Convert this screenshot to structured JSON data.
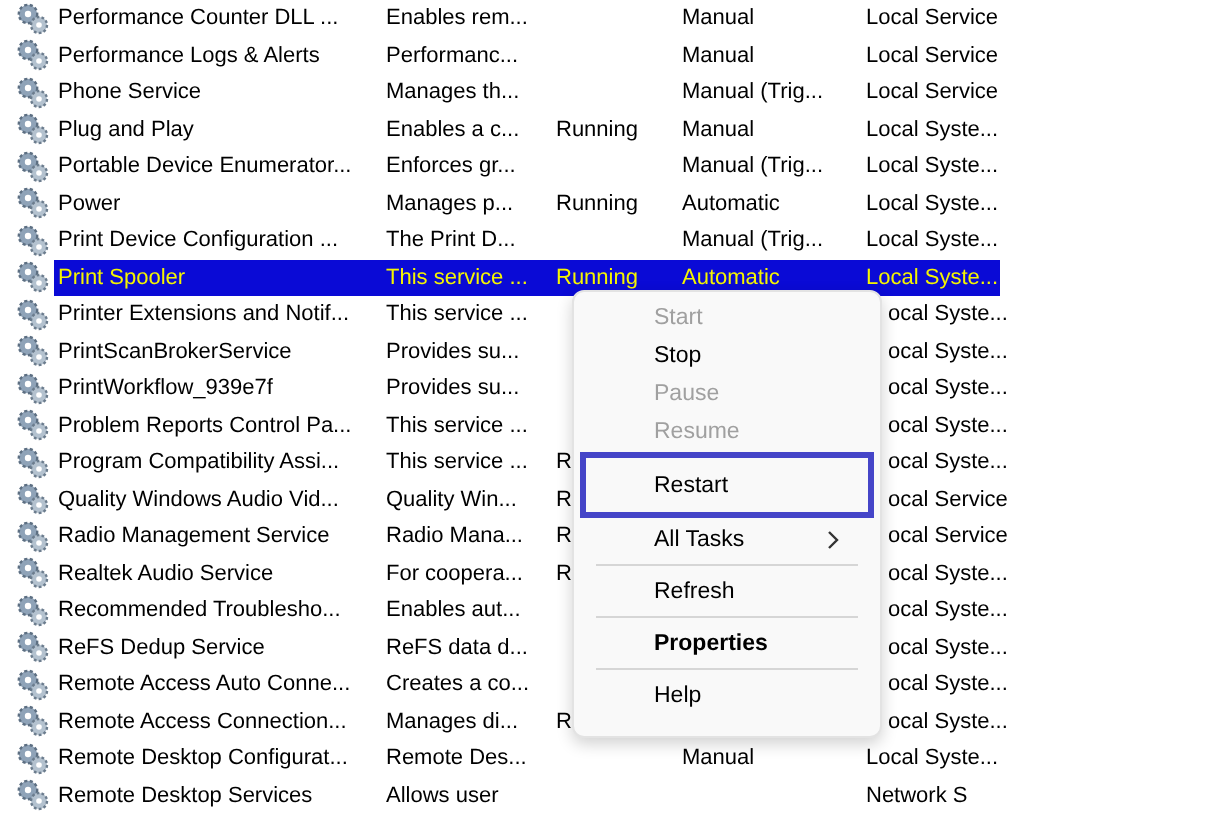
{
  "services": [
    {
      "name": "Performance Counter DLL ...",
      "description": "Enables rem...",
      "startup": "Manual",
      "logon": "Local Service",
      "selected": false
    },
    {
      "name": "Performance Logs & Alerts",
      "description": "Performanc...",
      "startup": "Manual",
      "logon": "Local Service",
      "selected": false
    },
    {
      "name": "Phone Service",
      "description": "Manages th...",
      "startup": "Manual (Trig...",
      "logon": "Local Service",
      "selected": false
    },
    {
      "name": "Plug and Play",
      "description": "Enables a c...",
      "status": "Running",
      "startup": "Manual",
      "logon": "Local Syste...",
      "selected": false
    },
    {
      "name": "Portable Device Enumerator...",
      "description": "Enforces gr...",
      "startup": "Manual (Trig...",
      "logon": "Local Syste...",
      "selected": false
    },
    {
      "name": "Power",
      "description": "Manages p...",
      "status": "Running",
      "startup": "Automatic",
      "logon": "Local Syste...",
      "selected": false
    },
    {
      "name": "Print Device Configuration ...",
      "description": "The Print D...",
      "startup": "Manual (Trig...",
      "logon": "Local Syste...",
      "selected": false
    },
    {
      "name": "Print Spooler",
      "description": "This service ...",
      "status": "Running",
      "startup": "Automatic",
      "logon": "Local Syste...",
      "selected": true
    },
    {
      "name": "Printer Extensions and Notif...",
      "description": "This service ...",
      "logon": "ocal Syste...",
      "selected": false
    },
    {
      "name": "PrintScanBrokerService",
      "description": "Provides su...",
      "logon": "ocal Syste...",
      "selected": false
    },
    {
      "name": "PrintWorkflow_939e7f",
      "description": "Provides su...",
      "logon": "ocal Syste...",
      "selected": false
    },
    {
      "name": "Problem Reports Control Pa...",
      "description": "This service ...",
      "logon": "ocal Syste...",
      "selected": false
    },
    {
      "name": "Program Compatibility Assi...",
      "description": "This service ...",
      "status": "R",
      "logon": "ocal Syste...",
      "selected": false
    },
    {
      "name": "Quality Windows Audio Vid...",
      "description": "Quality Win...",
      "status": "R",
      "logon": "ocal Service",
      "selected": false
    },
    {
      "name": "Radio Management Service",
      "description": "Radio Mana...",
      "status": "R",
      "logon": "ocal Service",
      "selected": false
    },
    {
      "name": "Realtek Audio Service",
      "description": "For coopera...",
      "status": "R",
      "logon": "ocal Syste...",
      "selected": false
    },
    {
      "name": "Recommended Troublesho...",
      "description": "Enables aut...",
      "logon": "ocal Syste...",
      "selected": false
    },
    {
      "name": "ReFS Dedup Service",
      "description": "ReFS data d...",
      "logon": "ocal Syste...",
      "selected": false
    },
    {
      "name": "Remote Access Auto Conne...",
      "description": "Creates a co...",
      "logon": "ocal Syste...",
      "selected": false
    },
    {
      "name": "Remote Access Connection...",
      "description": "Manages di...",
      "status": "R",
      "logon": "ocal Syste...",
      "selected": false
    },
    {
      "name": "Remote Desktop Configurat...",
      "description": "Remote Des...",
      "startup": "Manual",
      "logon": "Local Syste...",
      "selected": false
    },
    {
      "name": "Remote Desktop Services",
      "description": "Allows user",
      "logon": "Network S",
      "selected": false
    }
  ],
  "context_menu": {
    "items": [
      {
        "kind": "item",
        "label": "Start",
        "disabled": true,
        "selected": false
      },
      {
        "kind": "item",
        "label": "Stop",
        "disabled": false,
        "selected": false
      },
      {
        "kind": "item",
        "label": "Pause",
        "disabled": true,
        "selected": false
      },
      {
        "kind": "item",
        "label": "Resume",
        "disabled": true,
        "selected": false
      },
      {
        "kind": "item",
        "label": "Restart",
        "disabled": false,
        "selected": true
      },
      {
        "kind": "submenu",
        "label": "All Tasks",
        "disabled": false,
        "selected": false
      },
      {
        "kind": "separator"
      },
      {
        "kind": "item",
        "label": "Refresh",
        "disabled": false,
        "selected": false
      },
      {
        "kind": "separator"
      },
      {
        "kind": "default",
        "label": "Properties",
        "disabled": false,
        "selected": false
      },
      {
        "kind": "separator"
      },
      {
        "kind": "item",
        "label": "Help",
        "disabled": false,
        "selected": false
      }
    ]
  }
}
